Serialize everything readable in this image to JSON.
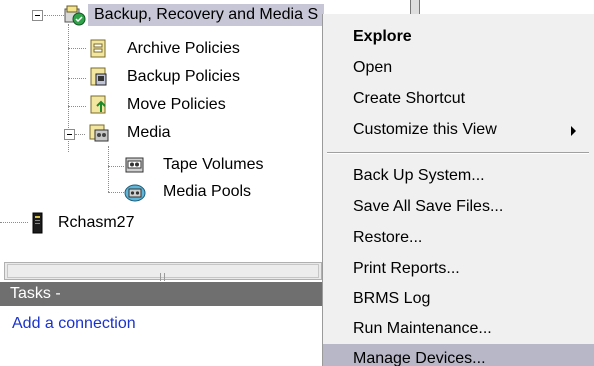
{
  "tree": {
    "root": {
      "label": "Backup, Recovery and Media S",
      "icon": "backup-recovery-icon"
    },
    "children": [
      {
        "label": "Archive Policies",
        "icon": "archive-policies-icon"
      },
      {
        "label": "Backup Policies",
        "icon": "backup-policies-icon"
      },
      {
        "label": "Move Policies",
        "icon": "move-policies-icon"
      },
      {
        "label": "Media",
        "icon": "media-icon"
      }
    ],
    "media_children": [
      {
        "label": "Tape Volumes",
        "icon": "tape-volumes-icon"
      },
      {
        "label": "Media Pools",
        "icon": "media-pools-icon"
      }
    ],
    "system": {
      "label": "Rchasm27",
      "icon": "system-server-icon"
    }
  },
  "tasks": {
    "header": "Tasks -",
    "link": "Add a connection"
  },
  "context_menu": {
    "items_top": [
      {
        "label": "Explore",
        "bold": true
      },
      {
        "label": "Open"
      },
      {
        "label": "Create Shortcut"
      },
      {
        "label": "Customize this View",
        "submenu": true
      }
    ],
    "items_bottom": [
      {
        "label": "Back Up System..."
      },
      {
        "label": "Save All Save Files..."
      },
      {
        "label": "Restore..."
      },
      {
        "label": "Print Reports..."
      },
      {
        "label": "BRMS Log"
      },
      {
        "label": "Run Maintenance..."
      },
      {
        "label": "Manage Devices...",
        "highlighted": true
      }
    ]
  },
  "colors": {
    "selection": "#c6c6d6",
    "menu_background": "#f0f0f0",
    "menu_highlight": "#b7b7c7",
    "tasks_header": "#6f6f6f",
    "link": "#1a33cc"
  }
}
